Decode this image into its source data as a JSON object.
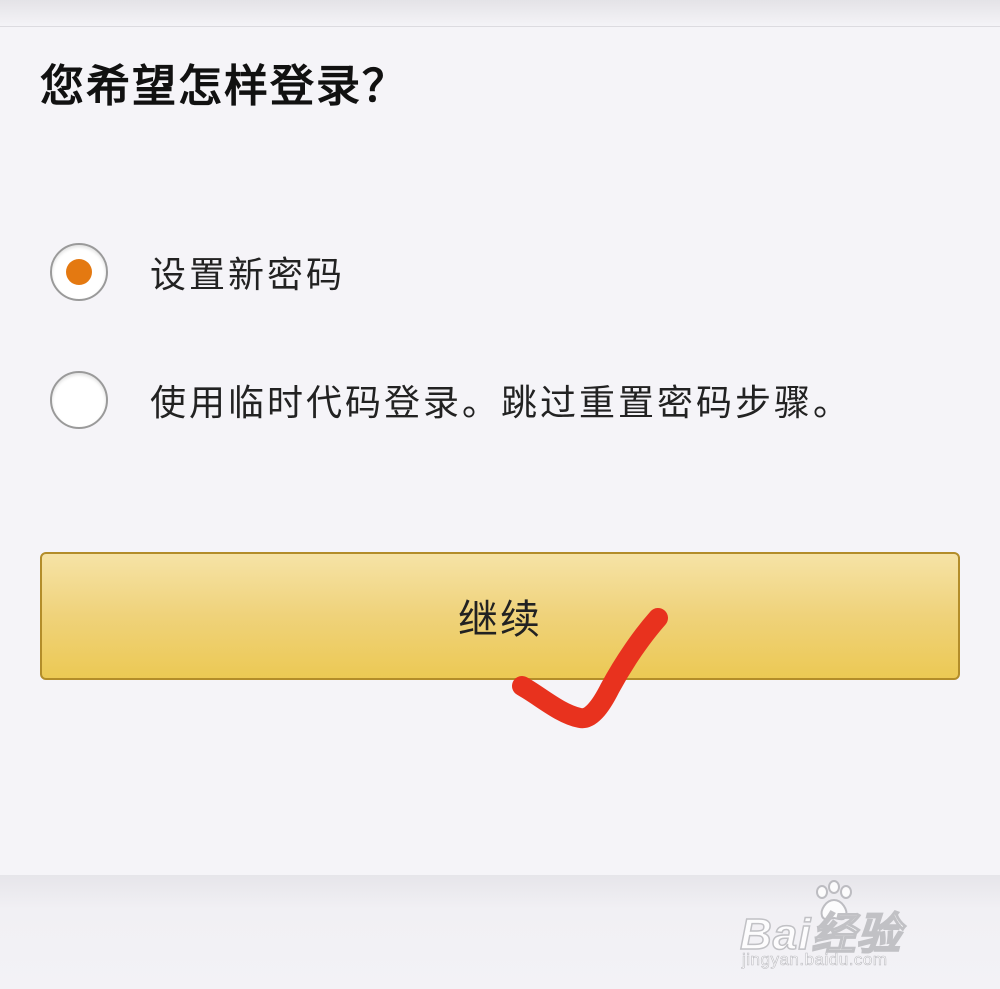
{
  "page": {
    "title": "您希望怎样登录？"
  },
  "options": [
    {
      "label": "设置新密码",
      "selected": true
    },
    {
      "label": "使用临时代码登录。跳过重置密码步骤。",
      "selected": false
    }
  ],
  "continue_button": {
    "label": "继续"
  },
  "annotation": {
    "icon": "check-mark-icon",
    "color": "#e8321e"
  },
  "watermark": {
    "logo": "Bai经验",
    "url": "jingyan.baidu.com"
  },
  "colors": {
    "accent_radio": "#e47911",
    "button_top": "#f6e3a6",
    "button_bottom": "#ecc954",
    "button_border": "#b38d2a"
  }
}
